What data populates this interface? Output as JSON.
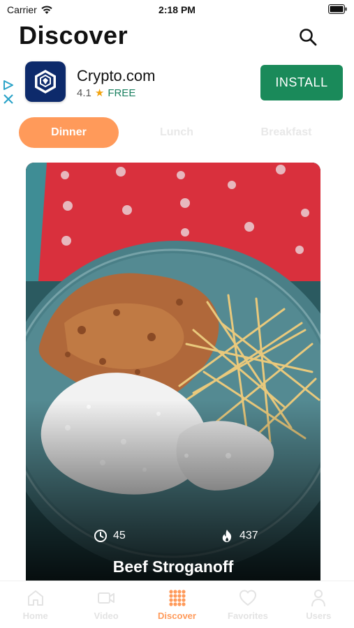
{
  "status_bar": {
    "carrier": "Carrier",
    "time": "2:18 PM"
  },
  "header": {
    "title": "Discover",
    "search_icon": "search-icon"
  },
  "ad": {
    "app_name": "Crypto.com",
    "rating": "4.1",
    "price": "FREE",
    "install_label": "INSTALL",
    "colors": {
      "button": "#1a8a5a",
      "logo_bg": "#0d2a6b"
    }
  },
  "tabs": [
    {
      "label": "Dinner",
      "active": true
    },
    {
      "label": "Lunch",
      "active": false
    },
    {
      "label": "Breakfast",
      "active": false
    }
  ],
  "recipe": {
    "title": "Beef Stroganoff",
    "time": "45",
    "calories": "437",
    "time_icon": "clock-icon",
    "calories_icon": "flame-icon"
  },
  "tab_bar": [
    {
      "label": "Home",
      "icon": "home-icon",
      "active": false
    },
    {
      "label": "Video",
      "icon": "video-icon",
      "active": false
    },
    {
      "label": "Discover",
      "icon": "grid-icon",
      "active": true
    },
    {
      "label": "Favorites",
      "icon": "heart-icon",
      "active": false
    },
    {
      "label": "Users",
      "icon": "user-icon",
      "active": false
    }
  ],
  "colors": {
    "accent": "#ff9a5a",
    "inactive": "#e3e3e3"
  }
}
